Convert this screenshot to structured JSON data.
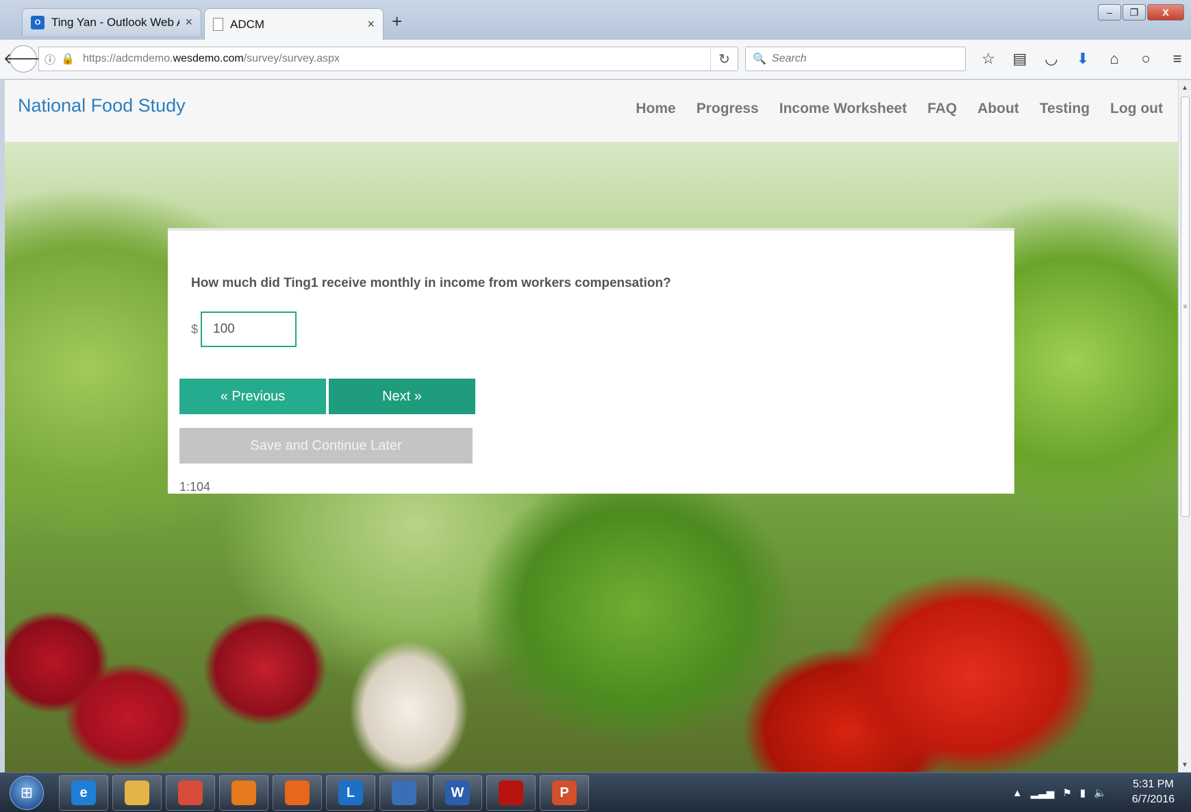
{
  "browser": {
    "tabs": [
      {
        "label": "Ting Yan - Outlook Web A...",
        "icon": "outlook-icon",
        "active": false
      },
      {
        "label": "ADCM",
        "icon": "document-icon",
        "active": true
      }
    ],
    "url": {
      "prefix": "https://adcmdemo.",
      "domain": "wesdemo.com",
      "path": "/survey/survey.aspx"
    },
    "search_placeholder": "Search"
  },
  "site": {
    "brand": "National Food Study",
    "nav": [
      "Home",
      "Progress",
      "Income Worksheet",
      "FAQ",
      "About",
      "Testing",
      "Log out"
    ]
  },
  "survey": {
    "question": "How much did Ting1 receive monthly in income from workers compensation?",
    "currency_symbol": "$",
    "amount_value": "100",
    "previous_label": "« Previous",
    "next_label": "Next »",
    "save_label": "Save and Continue Later",
    "question_id": "1:104"
  },
  "taskbar": {
    "apps": [
      {
        "name": "internet-explorer-icon",
        "letter": "e",
        "color": "#1f7fd6"
      },
      {
        "name": "file-explorer-icon",
        "letter": "",
        "color": "#e3b548"
      },
      {
        "name": "chrome-icon",
        "letter": "",
        "color": "#d94b3a"
      },
      {
        "name": "media-player-icon",
        "letter": "",
        "color": "#e67a1e"
      },
      {
        "name": "firefox-icon",
        "letter": "",
        "color": "#e8671b"
      },
      {
        "name": "lync-icon",
        "letter": "L",
        "color": "#1c71c7"
      },
      {
        "name": "remote-desktop-icon",
        "letter": "",
        "color": "#3a6fb8"
      },
      {
        "name": "word-icon",
        "letter": "W",
        "color": "#2b5fae"
      },
      {
        "name": "acrobat-icon",
        "letter": "",
        "color": "#b8140f"
      },
      {
        "name": "powerpoint-icon",
        "letter": "P",
        "color": "#d2502a"
      }
    ],
    "time": "5:31 PM",
    "date": "6/7/2016"
  },
  "colors": {
    "brand": "#2a7dbf",
    "primary_button": "#25ab8d",
    "disabled_button": "#c4c4c4"
  }
}
